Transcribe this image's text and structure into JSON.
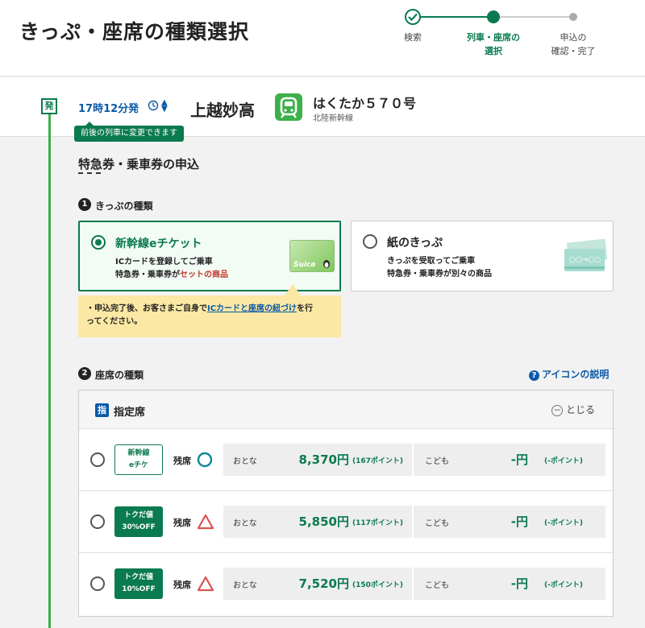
{
  "header": {
    "title": "きっぷ・座席の種類選択",
    "steps": [
      {
        "label_line1": "検索",
        "label_line2": ""
      },
      {
        "label_line1": "列車・座席の",
        "label_line2": "選択"
      },
      {
        "label_line1": "申込の",
        "label_line2": "確認・完了"
      }
    ]
  },
  "train": {
    "dep_badge": "発",
    "dep_time": "17時12分発",
    "tooltip": "前後の列車に変更できます",
    "station": "上越妙高",
    "name": "はくたか５７０号",
    "line": "北陸新幹線"
  },
  "section": {
    "title": "特急券・乗車券の申込",
    "ticket_type": {
      "number": "1",
      "heading": "きっぷの種類",
      "options": [
        {
          "title": "新幹線eチケット",
          "desc_line1": "ICカードを登録してご乗車",
          "desc_line2_prefix": "特急券・乗車券が",
          "desc_line2_highlight": "セットの商品",
          "card_text": "Suica"
        },
        {
          "title": "紙のきっぷ",
          "desc_line1": "きっぷを受取ってご乗車",
          "desc_line2": "特急券・乗車券が別々の商品"
        }
      ],
      "notice_prefix": "・申込完了後、お客さまご自身で",
      "notice_link": "ICカードと座席の紐づけ",
      "notice_suffix1": "を行",
      "notice_line2": "ってください。"
    },
    "seat_type": {
      "number": "2",
      "heading": "座席の種類",
      "help_icon": "?",
      "help_label": "アイコンの説明",
      "panel_badge": "指",
      "panel_label": "指定席",
      "close_label": "とじる",
      "rows": [
        {
          "tag_line1": "新幹線",
          "tag_line2": "eチケ",
          "tag_style": "outline",
          "avail_label": "残席",
          "avail_mark": "circle",
          "adult_label": "おとな",
          "adult_price": "8,370円",
          "adult_point": "(167ポイント)",
          "child_label": "こども",
          "child_price": "-円",
          "child_point": "(-ポイント)"
        },
        {
          "tag_line1": "トクだ値",
          "tag_line2": "30%OFF",
          "tag_style": "solid",
          "avail_label": "残席",
          "avail_mark": "triangle",
          "adult_label": "おとな",
          "adult_price": "5,850円",
          "adult_point": "(117ポイント)",
          "child_label": "こども",
          "child_price": "-円",
          "child_point": "(-ポイント)"
        },
        {
          "tag_line1": "トクだ値",
          "tag_line2": "10%OFF",
          "tag_style": "solid",
          "avail_label": "残席",
          "avail_mark": "triangle",
          "adult_label": "おとな",
          "adult_price": "7,520円",
          "adult_point": "(150ポイント)",
          "child_label": "こども",
          "child_price": "-円",
          "child_point": "(-ポイント)"
        }
      ]
    }
  },
  "colors": {
    "primary_green": "#0a7a4f",
    "timeline_green": "#3db04a",
    "link_blue": "#0a5aa8",
    "notice_yellow": "#fbe8a4",
    "alert_red": "#c0392b"
  }
}
